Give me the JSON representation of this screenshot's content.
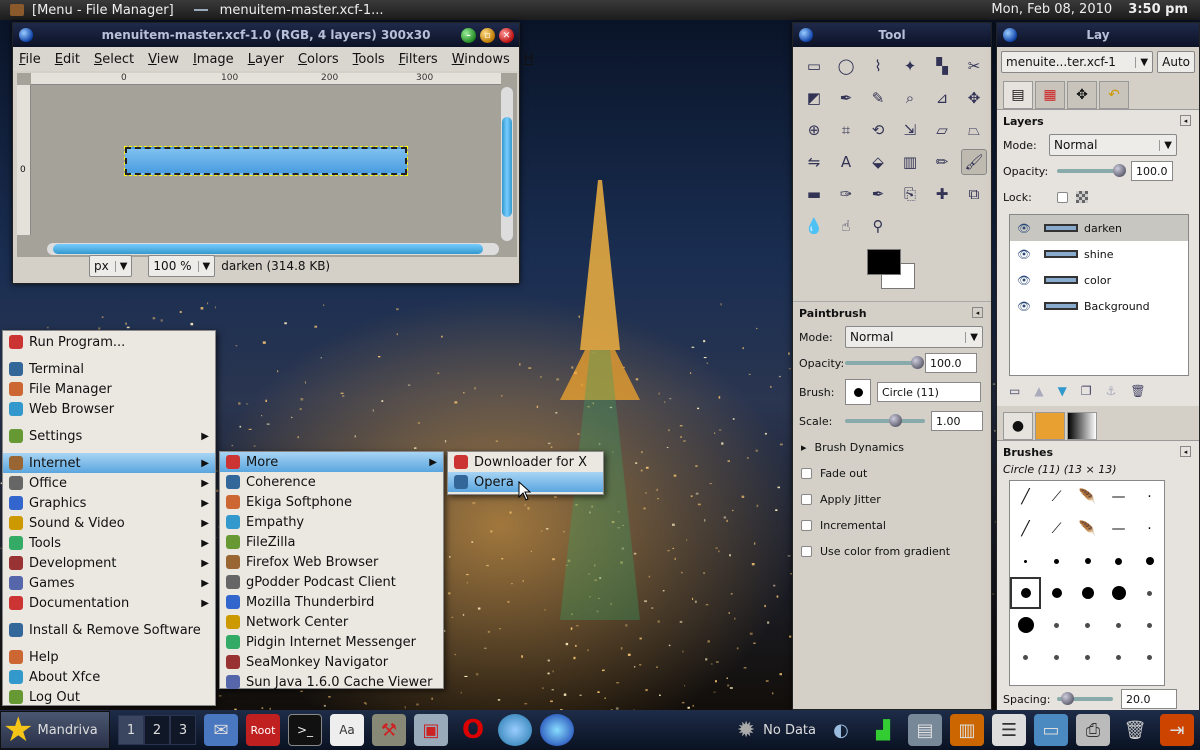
{
  "top_panel": {
    "menu_task": "[Menu - File Manager]",
    "image_task": "menuitem-master.xcf-1...",
    "date": "Mon, Feb 08, 2010",
    "time": "3:50 pm"
  },
  "image_window": {
    "title": "menuitem-master.xcf-1.0 (RGB, 4 layers) 300x30",
    "menus": [
      "File",
      "Edit",
      "Select",
      "View",
      "Image",
      "Layer",
      "Colors",
      "Tools",
      "Filters",
      "Windows",
      "H"
    ],
    "ruler_h_ticks": [
      "0",
      "100",
      "200",
      "300"
    ],
    "ruler_v_tick": "0",
    "unit": "px",
    "zoom": "100 %",
    "status": "darken (314.8 KB)"
  },
  "toolbox": {
    "title": "Tool",
    "tools": [
      "rect-select",
      "ellipse-select",
      "free-select",
      "fuzzy-select",
      "color-select",
      "scissors",
      "foreground-select",
      "paths",
      "color-picker",
      "zoom",
      "measure",
      "move",
      "align",
      "crop",
      "rotate",
      "scale",
      "shear",
      "perspective",
      "flip",
      "text",
      "bucket-fill",
      "blend",
      "pencil",
      "paintbrush",
      "eraser",
      "airbrush",
      "ink",
      "clone",
      "heal",
      "perspective-clone",
      "blur",
      "smudge",
      "dodge-burn"
    ],
    "options_title": "Paintbrush",
    "mode_label": "Mode:",
    "mode_value": "Normal",
    "opacity_label": "Opacity:",
    "opacity_value": "100.0",
    "opacity": 1.0,
    "brush_label": "Brush:",
    "brush_value": "Circle (11)",
    "scale_label": "Scale:",
    "scale_value": "1.00",
    "scale_fraction": 0.65,
    "brush_dynamics": "Brush Dynamics",
    "checks": [
      "Fade out",
      "Apply Jitter",
      "Incremental",
      "Use color from gradient"
    ]
  },
  "layers_dock": {
    "title": "Lay",
    "image_combo": "menuite...ter.xcf-1",
    "auto_label": "Auto",
    "layers_title": "Layers",
    "mode_label": "Mode:",
    "mode_value": "Normal",
    "opacity_label": "Opacity:",
    "opacity_value": "100.0",
    "lock_label": "Lock:",
    "layers": [
      {
        "name": "darken",
        "selected": true
      },
      {
        "name": "shine",
        "selected": false
      },
      {
        "name": "color",
        "selected": false
      },
      {
        "name": "Background",
        "selected": false
      }
    ],
    "brushes_title": "Brushes",
    "brushes_sub": "Circle (11) (13 × 13)",
    "spacing_label": "Spacing:",
    "spacing_value": "20.0"
  },
  "main_menu": {
    "items": [
      {
        "label": "Run Program...",
        "icon": "run-icon"
      },
      {
        "sep": true
      },
      {
        "label": "Terminal",
        "icon": "terminal-icon"
      },
      {
        "label": "File Manager",
        "icon": "folder-icon"
      },
      {
        "label": "Web Browser",
        "icon": "globe-icon"
      },
      {
        "sep": true
      },
      {
        "label": "Settings",
        "icon": "settings-icon",
        "submenu": true
      },
      {
        "sep": true
      },
      {
        "label": "Internet",
        "icon": "internet-icon",
        "submenu": true,
        "highlight": true
      },
      {
        "label": "Office",
        "icon": "office-icon",
        "submenu": true
      },
      {
        "label": "Graphics",
        "icon": "graphics-icon",
        "submenu": true
      },
      {
        "label": "Sound & Video",
        "icon": "sound-video-icon",
        "submenu": true
      },
      {
        "label": "Tools",
        "icon": "tools-icon",
        "submenu": true
      },
      {
        "label": "Development",
        "icon": "development-icon",
        "submenu": true
      },
      {
        "label": "Games",
        "icon": "games-icon",
        "submenu": true
      },
      {
        "label": "Documentation",
        "icon": "documentation-icon",
        "submenu": true
      },
      {
        "sep": true
      },
      {
        "label": "Install & Remove Software",
        "icon": "install-icon"
      },
      {
        "sep": true
      },
      {
        "label": "Help",
        "icon": "help-icon"
      },
      {
        "label": "About Xfce",
        "icon": "about-icon"
      },
      {
        "label": "Log Out",
        "icon": "logout-icon"
      }
    ]
  },
  "internet_menu": {
    "items": [
      {
        "label": "More",
        "icon": "more-icon",
        "submenu": true,
        "highlight": true
      },
      {
        "label": "Coherence",
        "icon": "coherence-icon"
      },
      {
        "label": "Ekiga Softphone",
        "icon": "ekiga-icon"
      },
      {
        "label": "Empathy",
        "icon": "empathy-icon"
      },
      {
        "label": "FileZilla",
        "icon": "filezilla-icon"
      },
      {
        "label": "Firefox Web Browser",
        "icon": "firefox-icon"
      },
      {
        "label": "gPodder Podcast Client",
        "icon": "gpodder-icon"
      },
      {
        "label": "Mozilla Thunderbird",
        "icon": "thunderbird-icon"
      },
      {
        "label": "Network Center",
        "icon": "network-icon"
      },
      {
        "label": "Pidgin Internet Messenger",
        "icon": "pidgin-icon"
      },
      {
        "label": "SeaMonkey Navigator",
        "icon": "seamonkey-icon"
      },
      {
        "label": "Sun Java 1.6.0 Cache Viewer",
        "icon": "java-icon"
      }
    ]
  },
  "more_menu": {
    "items": [
      {
        "label": "Downloader for X",
        "icon": "downloader-icon"
      },
      {
        "label": "Opera",
        "icon": "opera-icon",
        "highlight": true
      }
    ]
  },
  "bottom_panel": {
    "start_label": "Mandriva",
    "workspaces": [
      "1",
      "2",
      "3"
    ],
    "current_workspace": 0,
    "network_status": "No Data"
  },
  "colors": {
    "accent": "#5aa6e0",
    "titlebar": "#0c1226",
    "menu_bg": "#ebe8e2"
  }
}
